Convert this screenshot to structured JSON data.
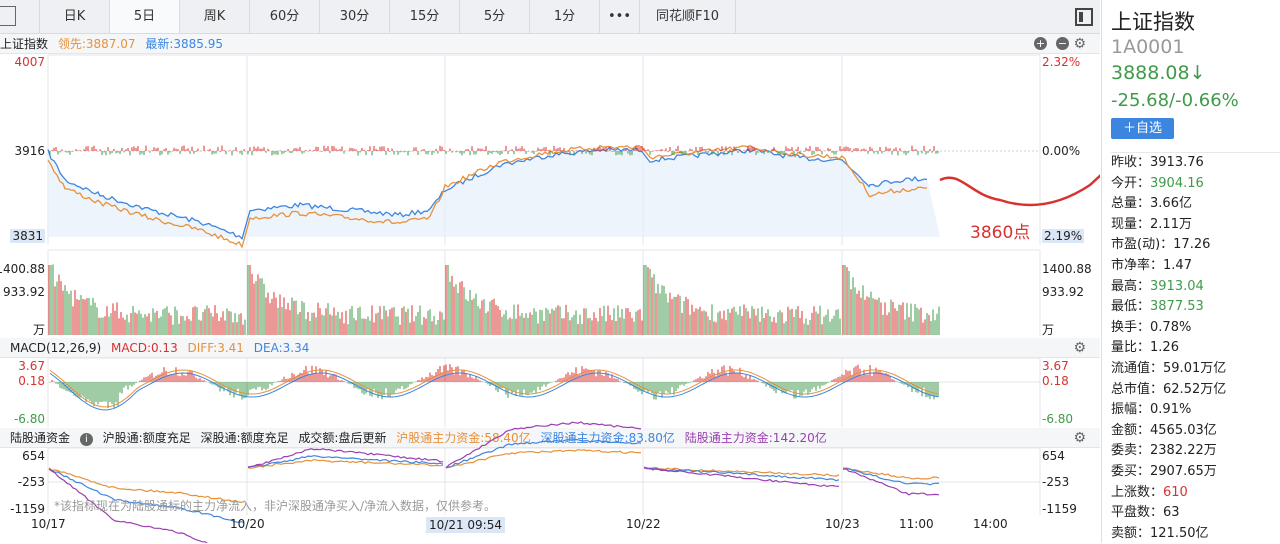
{
  "tabs": {
    "items": [
      "日K",
      "5日",
      "周K",
      "60分",
      "30分",
      "15分",
      "5分",
      "1分",
      "•••",
      "同花顺F10"
    ],
    "active": "5日"
  },
  "price_panel": {
    "name": "上证指数",
    "lead": "领先:3887.07",
    "latest": "最新:3885.95",
    "y_left": [
      "4007",
      "3916",
      "3831"
    ],
    "y_right": [
      "2.32%",
      "0.00%",
      "2.19%"
    ],
    "vol_left": [
      "1400.88",
      "933.92",
      "万"
    ],
    "vol_right": [
      "1400.88",
      "933.92",
      "万"
    ]
  },
  "macd": {
    "title": "MACD(12,26,9)",
    "macd": "MACD:0.13",
    "diff": "DIFF:3.41",
    "dea": "DEA:3.34",
    "y_left": [
      "3.67",
      "0.18",
      "-6.80"
    ],
    "y_right": [
      "3.67",
      "0.18",
      "-6.80"
    ]
  },
  "flow": {
    "title": "陆股通资金",
    "sh": "沪股通:额度充足",
    "sz": "深股通:额度充足",
    "vol": "成交额:盘后更新",
    "sh_main": "沪股通主力资金:58.40亿",
    "sz_main": "深股通主力资金:83.80亿",
    "hk_main": "陆股通主力资金:142.20亿",
    "note": "*该指标现在为陆股通标的主力净流入，非沪深股通净买入/净流入数据，仅供参考。",
    "y_left": [
      "654",
      "-253",
      "-1159"
    ],
    "y_right": [
      "654",
      "-253",
      "-1159"
    ]
  },
  "xaxis": [
    "10/17",
    "10/20",
    "10/21 09:54",
    "10/22",
    "10/23",
    "11:00",
    "14:00"
  ],
  "annotation": {
    "text": "3860点"
  },
  "quote": {
    "name": "上证指数",
    "code": "1A0001",
    "price": "3888.08↓",
    "change": "-25.68/-0.66%",
    "add_label": "＋自选",
    "stats": [
      [
        "昨收：",
        "3913.76",
        ""
      ],
      [
        "今开：",
        "3904.16",
        "g"
      ],
      [
        "总量：",
        "3.66亿",
        ""
      ],
      [
        "现量：",
        "2.11万",
        ""
      ],
      [
        "市盈(动)：",
        "17.26",
        ""
      ],
      [
        "市净率：",
        "1.47",
        ""
      ],
      [
        "最高：",
        "3913.04",
        "g"
      ],
      [
        "最低：",
        "3877.53",
        "g"
      ],
      [
        "换手：",
        "0.78%",
        ""
      ],
      [
        "量比：",
        "1.26",
        ""
      ],
      [
        "流通值：",
        "59.01万亿",
        ""
      ],
      [
        "总市值：",
        "62.52万亿",
        ""
      ],
      [
        "振幅：",
        "0.91%",
        ""
      ],
      [
        "金额：",
        "4565.03亿",
        ""
      ],
      [
        "委卖：",
        "2382.22万",
        ""
      ],
      [
        "委买：",
        "2907.65万",
        ""
      ],
      [
        "上涨数：",
        "610",
        "r"
      ],
      [
        "平盘数：",
        "63",
        ""
      ],
      [
        "卖额：",
        "121.50亿",
        ""
      ]
    ]
  },
  "colors": {
    "up": "#d8322f",
    "down": "#3f9a49",
    "orange": "#e8913a",
    "blue": "#3d86e0",
    "purple": "#9b3fb0"
  }
}
